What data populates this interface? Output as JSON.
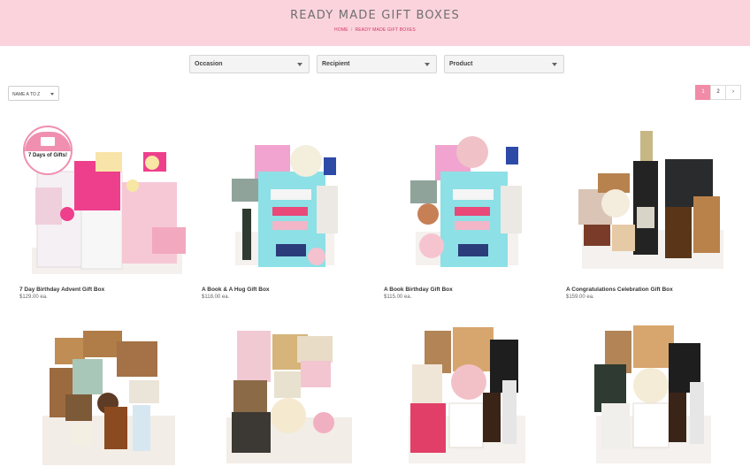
{
  "page": {
    "title": "READY MADE GIFT BOXES",
    "breadcrumb": {
      "home": "HOME",
      "separator": "/",
      "current": "READY MADE GIFT BOXES"
    }
  },
  "filters": [
    {
      "label": "Occasion"
    },
    {
      "label": "Recipient"
    },
    {
      "label": "Product"
    }
  ],
  "sort": {
    "selected": "NAME A TO Z"
  },
  "pagination": {
    "pages": [
      "1",
      "2"
    ],
    "active": "1",
    "next_icon": "chevron-right-icon",
    "next_glyph": "›"
  },
  "products": [
    {
      "name": "7 Day Birthday Advent Gift Box",
      "price": "$129.00 ea.",
      "badge": "7 Days of Gifts!"
    },
    {
      "name": "A Book & A Hug Gift Box",
      "price": "$118.00 ea."
    },
    {
      "name": "A Book Birthday Gift Box",
      "price": "$115.00 ea."
    },
    {
      "name": "A Congratulations Celebration Gift Box",
      "price": "$159.00 ea."
    },
    {
      "name": "",
      "price": ""
    },
    {
      "name": "",
      "price": ""
    },
    {
      "name": "",
      "price": ""
    },
    {
      "name": "",
      "price": ""
    }
  ],
  "colors": {
    "hero_bg": "#fbd3dd",
    "accent_pink": "#f28ba8",
    "breadcrumb": "#d0345d"
  }
}
